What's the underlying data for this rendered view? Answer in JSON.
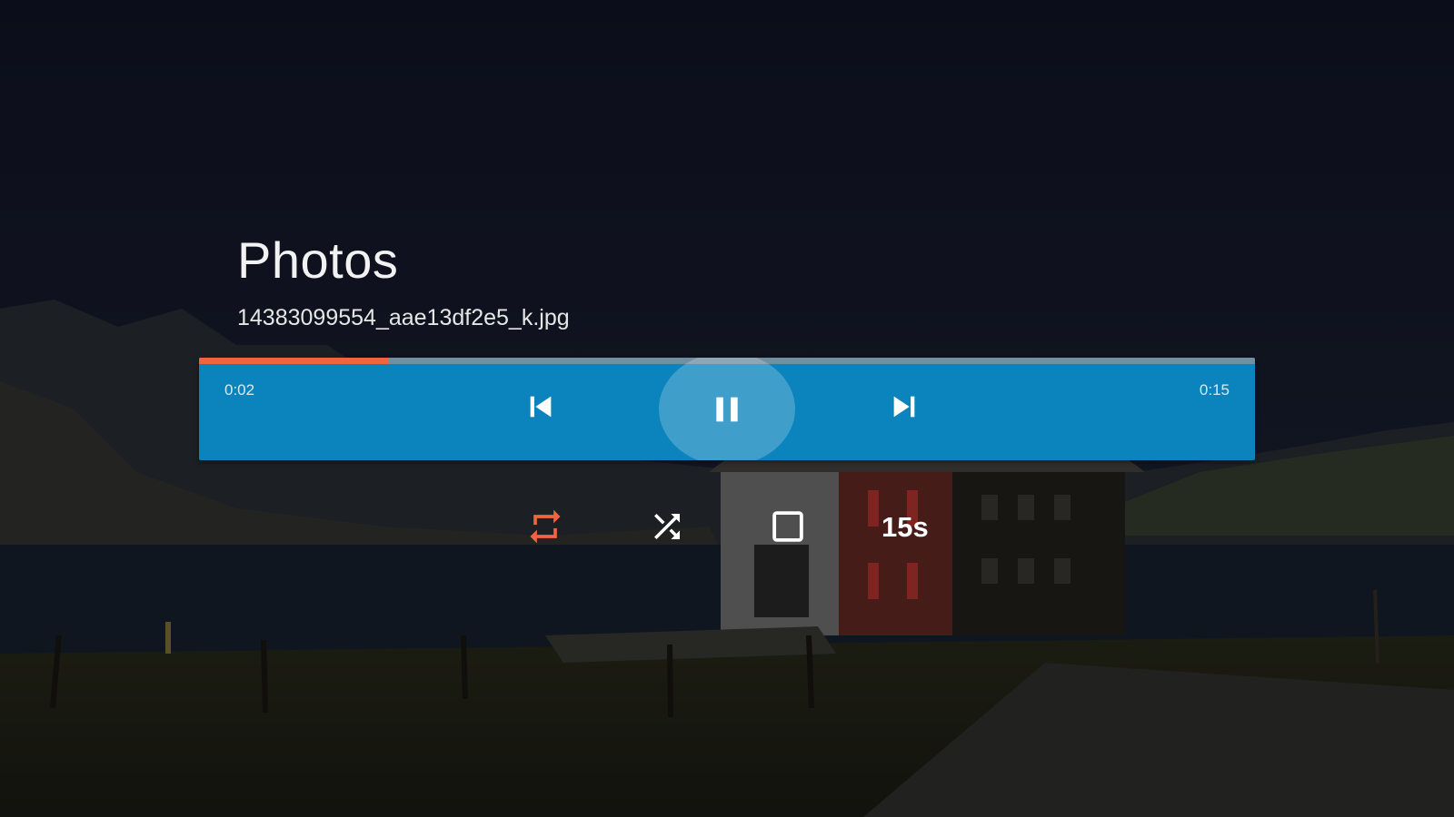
{
  "app": {
    "title": "Photos",
    "filename": "14383099554_aae13df2e5_k.jpg"
  },
  "player": {
    "elapsed": "0:02",
    "total": "0:15",
    "progress_fraction": 0.18,
    "state": "playing",
    "icons": {
      "previous": "skip-previous-icon",
      "pause": "pause-icon",
      "next": "skip-next-icon"
    }
  },
  "options": {
    "repeat_icon": "repeat-icon",
    "shuffle_icon": "shuffle-icon",
    "fit_icon": "crop-square-icon",
    "interval_label": "15s"
  },
  "colors": {
    "accent": "#f2643f",
    "player_bar": "#0b83bd",
    "progress_track": "#6f8fa3",
    "text": "#ffffff"
  }
}
